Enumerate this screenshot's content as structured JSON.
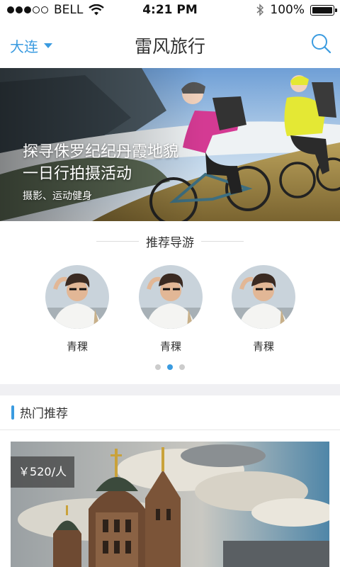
{
  "status": {
    "carrier": "BELL",
    "time": "4:21 PM",
    "battery": "100%"
  },
  "nav": {
    "city": "大连",
    "title": "雷风旅行"
  },
  "banner": {
    "title_line1": "探寻侏罗纪纪丹霞地貌",
    "title_line2": "一日行拍摄活动",
    "tags": "摄影、运动健身"
  },
  "guides": {
    "title": "推荐导游",
    "items": [
      {
        "name": "青稞"
      },
      {
        "name": "青稞"
      },
      {
        "name": "青稞"
      }
    ],
    "pager_active": 1
  },
  "hot": {
    "title": "热门推荐",
    "card": {
      "price": "￥520/人"
    }
  }
}
